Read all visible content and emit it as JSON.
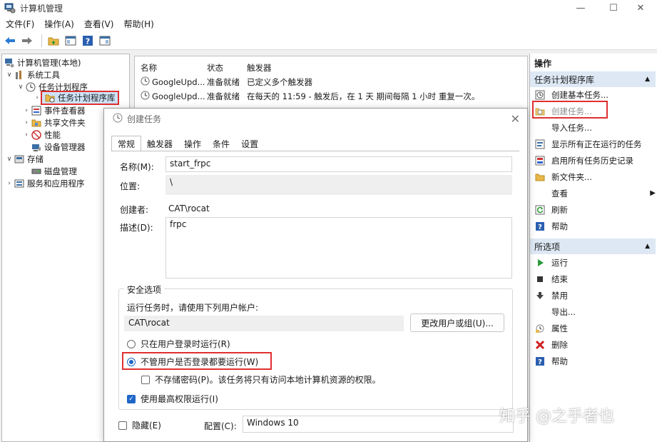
{
  "window": {
    "title": "计算机管理"
  },
  "menu": [
    "文件(F)",
    "操作(A)",
    "查看(V)",
    "帮助(H)"
  ],
  "tree": {
    "root": "计算机管理(本地)",
    "system_tools": "系统工具",
    "task_scheduler": "任务计划程序",
    "task_scheduler_lib": "任务计划程序库",
    "event_viewer": "事件查看器",
    "shared_folders": "共享文件夹",
    "performance": "性能",
    "device_manager": "设备管理器",
    "storage": "存储",
    "disk_management": "磁盘管理",
    "services_apps": "服务和应用程序"
  },
  "list": {
    "headers": [
      "名称",
      "状态",
      "触发器"
    ],
    "rows": [
      {
        "name": "GoogleUpd...",
        "status": "准备就绪",
        "trigger": "已定义多个触发器"
      },
      {
        "name": "GoogleUpd...",
        "status": "准备就绪",
        "trigger": "在每天的 11:59 - 触发后，在 1 天 期间每隔 1 小时 重复一次。"
      }
    ]
  },
  "actions": {
    "header": "操作",
    "section1": "任务计划程序库",
    "items1": [
      {
        "label": "创建基本任务...",
        "icon": "basic-task-icon"
      },
      {
        "label": "创建任务...",
        "icon": "create-task-icon"
      },
      {
        "label": "导入任务...",
        "icon": ""
      },
      {
        "label": "显示所有正在运行的任务",
        "icon": "running-tasks-icon"
      },
      {
        "label": "启用所有任务历史记录",
        "icon": "history-icon"
      },
      {
        "label": "新文件夹...",
        "icon": "folder-icon"
      },
      {
        "label": "查看",
        "icon": ""
      },
      {
        "label": "刷新",
        "icon": "refresh-icon"
      },
      {
        "label": "帮助",
        "icon": "help-icon"
      }
    ],
    "section2": "所选项",
    "items2": [
      {
        "label": "运行",
        "icon": "run-icon"
      },
      {
        "label": "结束",
        "icon": "stop-icon"
      },
      {
        "label": "禁用",
        "icon": "disable-icon"
      },
      {
        "label": "导出...",
        "icon": ""
      },
      {
        "label": "属性",
        "icon": "properties-icon"
      },
      {
        "label": "删除",
        "icon": "delete-icon"
      },
      {
        "label": "帮助",
        "icon": "help-icon"
      }
    ]
  },
  "dialog": {
    "title": "创建任务",
    "tabs": [
      "常规",
      "触发器",
      "操作",
      "条件",
      "设置"
    ],
    "name_label": "名称(M):",
    "name_value": "start_frpc",
    "location_label": "位置:",
    "location_value": "\\",
    "author_label": "创建者:",
    "author_value": "CAT\\rocat",
    "desc_label": "描述(D):",
    "desc_value": "frpc",
    "security_title": "安全选项",
    "security_prompt": "运行任务时，请使用下列用户帐户:",
    "account_value": "CAT\\rocat",
    "change_user_button": "更改用户或组(U)...",
    "radio_logged_on": "只在用户登录时运行(R)",
    "radio_whether": "不管用户是否登录都要运行(W)",
    "no_store_pw": "不存储密码(P)。该任务将只有访问本地计算机资源的权限。",
    "highest_priv": "使用最高权限运行(I)",
    "hidden_label": "隐藏(E)",
    "config_label": "配置(C):",
    "config_value": "Windows 10"
  },
  "watermark": "知乎 @之乎者也"
}
